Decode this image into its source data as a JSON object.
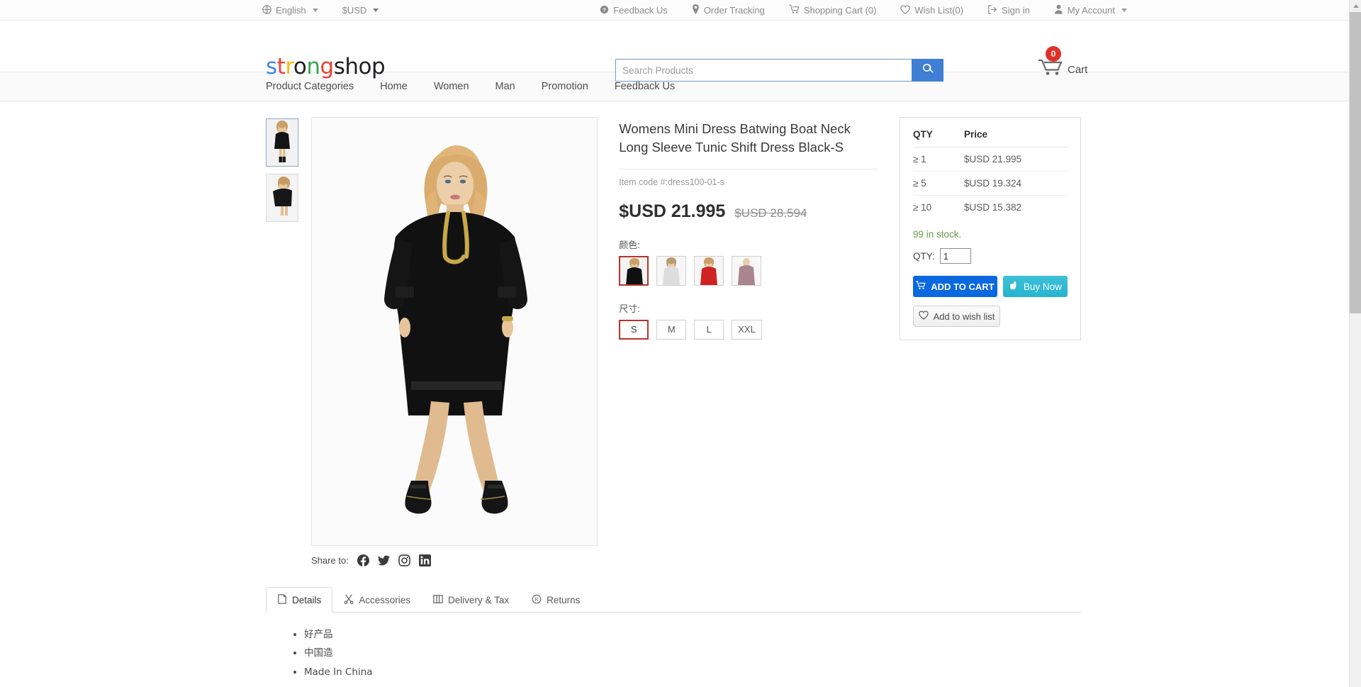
{
  "topbar": {
    "language": "English",
    "currency": "$USD",
    "links": [
      {
        "label": "Feedback Us",
        "icon": "question-circle-icon"
      },
      {
        "label": "Order Tracking",
        "icon": "location-pin-icon"
      },
      {
        "label": "Shopping Cart (0)",
        "icon": "cart-icon"
      },
      {
        "label": "Wish List(0)",
        "icon": "heart-icon"
      },
      {
        "label": "Sign in",
        "icon": "sign-in-icon"
      },
      {
        "label": "My Account",
        "icon": "user-icon"
      }
    ]
  },
  "header": {
    "logo": [
      {
        "text": "s",
        "color": "#4285f4"
      },
      {
        "text": "t",
        "color": "#ea4335"
      },
      {
        "text": "r",
        "color": "#fbbc05"
      },
      {
        "text": "o",
        "color": "#202124"
      },
      {
        "text": "n",
        "color": "#34a853"
      },
      {
        "text": "g",
        "color": "#ea4335"
      },
      {
        "text": "shop",
        "color": "#202124"
      }
    ],
    "search_placeholder": "Search Products",
    "search_value": "",
    "cart_count": "0",
    "cart_label": "Cart"
  },
  "nav": {
    "items": [
      "Product Categories",
      "Home",
      "Women",
      "Man",
      "Promotion",
      "Feedback Us"
    ]
  },
  "product": {
    "title": "Womens Mini Dress Batwing Boat Neck Long Sleeve Tunic Shift Dress Black-S",
    "item_code": "Item code #:dress100-01-s",
    "price_now": "$USD 21.995",
    "price_old": "$USD 28.594",
    "color_label": "颜色:",
    "size_label": "尺寸:",
    "colors": [
      {
        "name": "black",
        "selected": true
      },
      {
        "name": "white",
        "selected": false
      },
      {
        "name": "red",
        "selected": false
      },
      {
        "name": "mauve",
        "selected": false
      }
    ],
    "sizes": [
      {
        "label": "S",
        "selected": true
      },
      {
        "label": "M",
        "selected": false
      },
      {
        "label": "L",
        "selected": false
      },
      {
        "label": "XXL",
        "selected": false
      }
    ]
  },
  "panel": {
    "qty_header": "QTY",
    "price_header": "Price",
    "tiers": [
      {
        "qty": "≥  1",
        "price": "$USD 21.995"
      },
      {
        "qty": "≥  5",
        "price": "$USD 19.324"
      },
      {
        "qty": "≥  10",
        "price": "$USD 15.382"
      }
    ],
    "stock": "99 in stock.",
    "qty_label": "QTY:",
    "qty_value": "1",
    "add_to_cart": "ADD TO CART",
    "buy_now": "Buy Now",
    "add_to_wish": "Add to wish list"
  },
  "share": {
    "label": "Share to:",
    "networks": [
      "facebook-icon",
      "twitter-icon",
      "instagram-icon",
      "linkedin-icon"
    ]
  },
  "tabs": {
    "items": [
      {
        "label": "Details",
        "icon": "note-icon",
        "active": true
      },
      {
        "label": "Accessories",
        "icon": "scissors-icon",
        "active": false
      },
      {
        "label": "Delivery & Tax",
        "icon": "columns-icon",
        "active": false
      },
      {
        "label": "Returns",
        "icon": "registered-icon",
        "active": false
      }
    ],
    "details_bullets": [
      "好产品",
      "中国造",
      "Made In China"
    ]
  },
  "colors": {
    "accent_blue": "#0a68e0",
    "teal": "#26b4cf",
    "badge_red": "#e03027",
    "stock_green": "#6b9a4f",
    "selected_border": "#b5342b"
  }
}
